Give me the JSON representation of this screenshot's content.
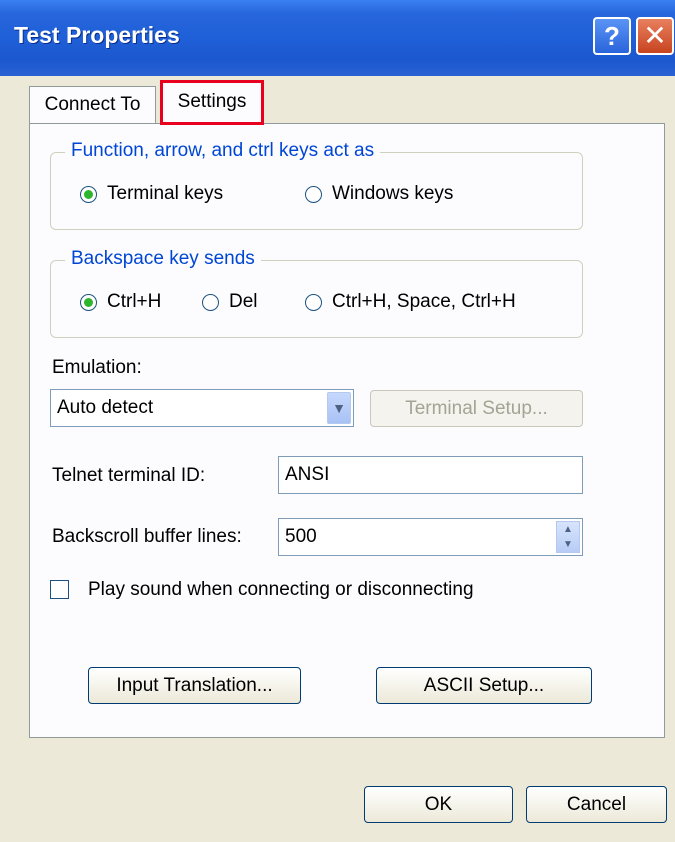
{
  "window": {
    "title": "Test Properties",
    "help_glyph": "?",
    "close_glyph": "✕"
  },
  "tabs": [
    {
      "label": "Connect To",
      "selected": false
    },
    {
      "label": "Settings",
      "selected": true
    }
  ],
  "function_keys_group": {
    "legend": "Function, arrow, and ctrl keys act as",
    "options": [
      {
        "label": "Terminal keys",
        "selected": true
      },
      {
        "label": "Windows keys",
        "selected": false
      }
    ]
  },
  "backspace_group": {
    "legend": "Backspace key sends",
    "options": [
      {
        "label": "Ctrl+H",
        "selected": true
      },
      {
        "label": "Del",
        "selected": false
      },
      {
        "label": "Ctrl+H, Space, Ctrl+H",
        "selected": false
      }
    ]
  },
  "emulation": {
    "label": "Emulation:",
    "value": "Auto detect",
    "terminal_setup_label": "Terminal Setup..."
  },
  "telnet": {
    "label": "Telnet terminal ID:",
    "value": "ANSI"
  },
  "backscroll": {
    "label": "Backscroll buffer lines:",
    "value": "500"
  },
  "play_sound": {
    "label": "Play sound when connecting or disconnecting",
    "checked": false
  },
  "buttons": {
    "input_translation": "Input Translation...",
    "ascii_setup": "ASCII Setup...",
    "ok": "OK",
    "cancel": "Cancel"
  },
  "colors": {
    "titlebar": "#2766dc",
    "group_legend": "#0046d5",
    "selected_tab_outline": "#e8001e",
    "radio_selected": "#2db52d"
  }
}
